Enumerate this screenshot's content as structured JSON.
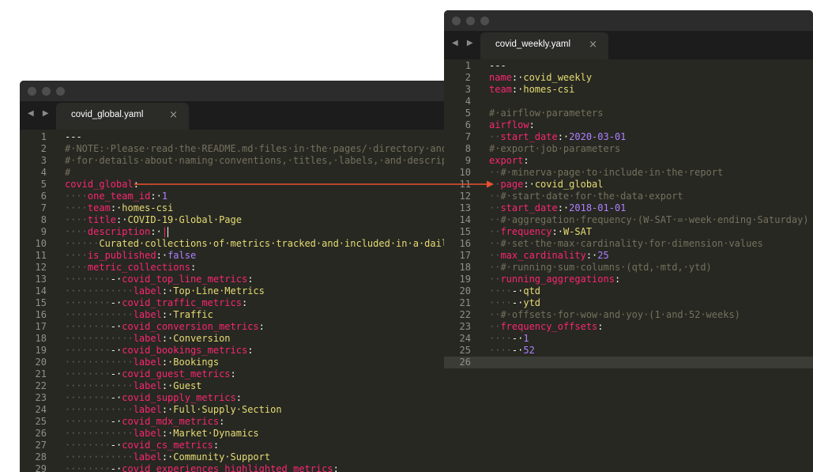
{
  "window1": {
    "tab_label": "covid_global.yaml",
    "close_glyph": "×",
    "nav_arrows": "◀ ▶",
    "lines": [
      [
        [
          "p",
          "---"
        ]
      ],
      [
        [
          "c",
          "#·NOTE:·Please·read·the·README.md·files·in·the·pages/·directory·and·r"
        ]
      ],
      [
        [
          "c",
          "#·for·details·about·naming·conventions,·titles,·labels,·and·descripti"
        ]
      ],
      [
        [
          "c",
          "#"
        ]
      ],
      [
        [
          "k",
          "covid_global"
        ],
        [
          "p",
          ":"
        ]
      ],
      [
        [
          "ws",
          "····"
        ],
        [
          "k",
          "one_team_id"
        ],
        [
          "p",
          ":·"
        ],
        [
          "n",
          "1"
        ]
      ],
      [
        [
          "ws",
          "····"
        ],
        [
          "k",
          "team"
        ],
        [
          "p",
          ":·"
        ],
        [
          "v",
          "homes-csi"
        ]
      ],
      [
        [
          "ws",
          "····"
        ],
        [
          "k",
          "title"
        ],
        [
          "p",
          ":·"
        ],
        [
          "v",
          "COVID-19·Global·Page"
        ]
      ],
      [
        [
          "ws",
          "····"
        ],
        [
          "k",
          "description"
        ],
        [
          "p",
          ":·"
        ],
        [
          "k",
          "|"
        ]
      ],
      [
        [
          "ws",
          "······"
        ],
        [
          "v",
          "Curated·collections·of·metrics·tracked·and·included·in·a·daily"
        ]
      ],
      [
        [
          "ws",
          "····"
        ],
        [
          "k",
          "is_published"
        ],
        [
          "p",
          ":·"
        ],
        [
          "n",
          "false"
        ]
      ],
      [
        [
          "ws",
          "····"
        ],
        [
          "k",
          "metric_collections"
        ],
        [
          "p",
          ":"
        ]
      ],
      [
        [
          "ws",
          "········"
        ],
        [
          "p",
          "-·"
        ],
        [
          "k",
          "covid_top_line_metrics"
        ],
        [
          "p",
          ":"
        ]
      ],
      [
        [
          "ws",
          "············"
        ],
        [
          "k",
          "label"
        ],
        [
          "p",
          ":·"
        ],
        [
          "v",
          "Top·Line·Metrics"
        ]
      ],
      [
        [
          "ws",
          "········"
        ],
        [
          "p",
          "-·"
        ],
        [
          "k",
          "covid_traffic_metrics"
        ],
        [
          "p",
          ":"
        ]
      ],
      [
        [
          "ws",
          "············"
        ],
        [
          "k",
          "label"
        ],
        [
          "p",
          ":·"
        ],
        [
          "v",
          "Traffic"
        ]
      ],
      [
        [
          "ws",
          "········"
        ],
        [
          "p",
          "-·"
        ],
        [
          "k",
          "covid_conversion_metrics"
        ],
        [
          "p",
          ":"
        ]
      ],
      [
        [
          "ws",
          "············"
        ],
        [
          "k",
          "label"
        ],
        [
          "p",
          ":·"
        ],
        [
          "v",
          "Conversion"
        ]
      ],
      [
        [
          "ws",
          "········"
        ],
        [
          "p",
          "-·"
        ],
        [
          "k",
          "covid_bookings_metrics"
        ],
        [
          "p",
          ":"
        ]
      ],
      [
        [
          "ws",
          "············"
        ],
        [
          "k",
          "label"
        ],
        [
          "p",
          ":·"
        ],
        [
          "v",
          "Bookings"
        ]
      ],
      [
        [
          "ws",
          "········"
        ],
        [
          "p",
          "-·"
        ],
        [
          "k",
          "covid_guest_metrics"
        ],
        [
          "p",
          ":"
        ]
      ],
      [
        [
          "ws",
          "············"
        ],
        [
          "k",
          "label"
        ],
        [
          "p",
          ":·"
        ],
        [
          "v",
          "Guest"
        ]
      ],
      [
        [
          "ws",
          "········"
        ],
        [
          "p",
          "-·"
        ],
        [
          "k",
          "covid_supply_metrics"
        ],
        [
          "p",
          ":"
        ]
      ],
      [
        [
          "ws",
          "············"
        ],
        [
          "k",
          "label"
        ],
        [
          "p",
          ":·"
        ],
        [
          "v",
          "Full·Supply·Section"
        ]
      ],
      [
        [
          "ws",
          "········"
        ],
        [
          "p",
          "-·"
        ],
        [
          "k",
          "covid_mdx_metrics"
        ],
        [
          "p",
          ":"
        ]
      ],
      [
        [
          "ws",
          "············"
        ],
        [
          "k",
          "label"
        ],
        [
          "p",
          ":·"
        ],
        [
          "v",
          "Market·Dynamics"
        ]
      ],
      [
        [
          "ws",
          "········"
        ],
        [
          "p",
          "-·"
        ],
        [
          "k",
          "covid_cs_metrics"
        ],
        [
          "p",
          ":"
        ]
      ],
      [
        [
          "ws",
          "············"
        ],
        [
          "k",
          "label"
        ],
        [
          "p",
          ":·"
        ],
        [
          "v",
          "Community·Support"
        ]
      ],
      [
        [
          "ws",
          "········"
        ],
        [
          "p",
          "-·"
        ],
        [
          "k",
          "covid_experiences_highlighted_metrics"
        ],
        [
          "p",
          ":"
        ]
      ]
    ]
  },
  "window2": {
    "tab_label": "covid_weekly.yaml",
    "close_glyph": "×",
    "nav_arrows": "◀ ▶",
    "lines": [
      [
        [
          "p",
          "---"
        ]
      ],
      [
        [
          "k",
          "name"
        ],
        [
          "p",
          ":·"
        ],
        [
          "v",
          "covid_weekly"
        ]
      ],
      [
        [
          "k",
          "team"
        ],
        [
          "p",
          ":·"
        ],
        [
          "v",
          "homes-csi"
        ]
      ],
      [],
      [
        [
          "c",
          "#·airflow·parameters"
        ]
      ],
      [
        [
          "k",
          "airflow"
        ],
        [
          "p",
          ":"
        ]
      ],
      [
        [
          "ws",
          "··"
        ],
        [
          "k",
          "start_date"
        ],
        [
          "p",
          ":·"
        ],
        [
          "n",
          "2020-03-01"
        ]
      ],
      [
        [
          "c",
          "#·export·job·parameters"
        ]
      ],
      [
        [
          "k",
          "export"
        ],
        [
          "p",
          ":"
        ]
      ],
      [
        [
          "ws",
          "··"
        ],
        [
          "c",
          "#·minerva·page·to·include·in·the·report"
        ]
      ],
      [
        [
          "ws",
          "··"
        ],
        [
          "k",
          "page"
        ],
        [
          "p",
          ":·"
        ],
        [
          "v",
          "covid_global"
        ]
      ],
      [
        [
          "ws",
          "··"
        ],
        [
          "c",
          "#·start·date·for·the·data·export"
        ]
      ],
      [
        [
          "ws",
          "··"
        ],
        [
          "k",
          "start_date"
        ],
        [
          "p",
          ":·"
        ],
        [
          "n",
          "2018-01-01"
        ]
      ],
      [
        [
          "ws",
          "··"
        ],
        [
          "c",
          "#·aggregation·frequency·(W-SAT·=·week·ending·Saturday)"
        ]
      ],
      [
        [
          "ws",
          "··"
        ],
        [
          "k",
          "frequency"
        ],
        [
          "p",
          ":·"
        ],
        [
          "v",
          "W-SAT"
        ]
      ],
      [
        [
          "ws",
          "··"
        ],
        [
          "c",
          "#·set·the·max·cardinality·for·dimension·values"
        ]
      ],
      [
        [
          "ws",
          "··"
        ],
        [
          "k",
          "max_cardinality"
        ],
        [
          "p",
          ":·"
        ],
        [
          "n",
          "25"
        ]
      ],
      [
        [
          "ws",
          "··"
        ],
        [
          "c",
          "#·running·sum·columns·(qtd,·mtd,·ytd)"
        ]
      ],
      [
        [
          "ws",
          "··"
        ],
        [
          "k",
          "running_aggregations"
        ],
        [
          "p",
          ":"
        ]
      ],
      [
        [
          "ws",
          "····"
        ],
        [
          "p",
          "-·"
        ],
        [
          "v",
          "qtd"
        ]
      ],
      [
        [
          "ws",
          "····"
        ],
        [
          "p",
          "-·"
        ],
        [
          "v",
          "ytd"
        ]
      ],
      [
        [
          "ws",
          "··"
        ],
        [
          "c",
          "#·offsets·for·wow·and·yoy·(1·and·52·weeks)"
        ]
      ],
      [
        [
          "ws",
          "··"
        ],
        [
          "k",
          "frequency_offsets"
        ],
        [
          "p",
          ":"
        ]
      ],
      [
        [
          "ws",
          "····"
        ],
        [
          "p",
          "-·"
        ],
        [
          "n",
          "1"
        ]
      ],
      [
        [
          "ws",
          "····"
        ],
        [
          "p",
          "-·"
        ],
        [
          "n",
          "52"
        ]
      ],
      []
    ]
  },
  "colors": {
    "background": "#272822",
    "key": "#f92672",
    "string": "#e6db74",
    "number": "#ae81ff",
    "comment": "#75715e",
    "arrow": "#e8502e"
  }
}
